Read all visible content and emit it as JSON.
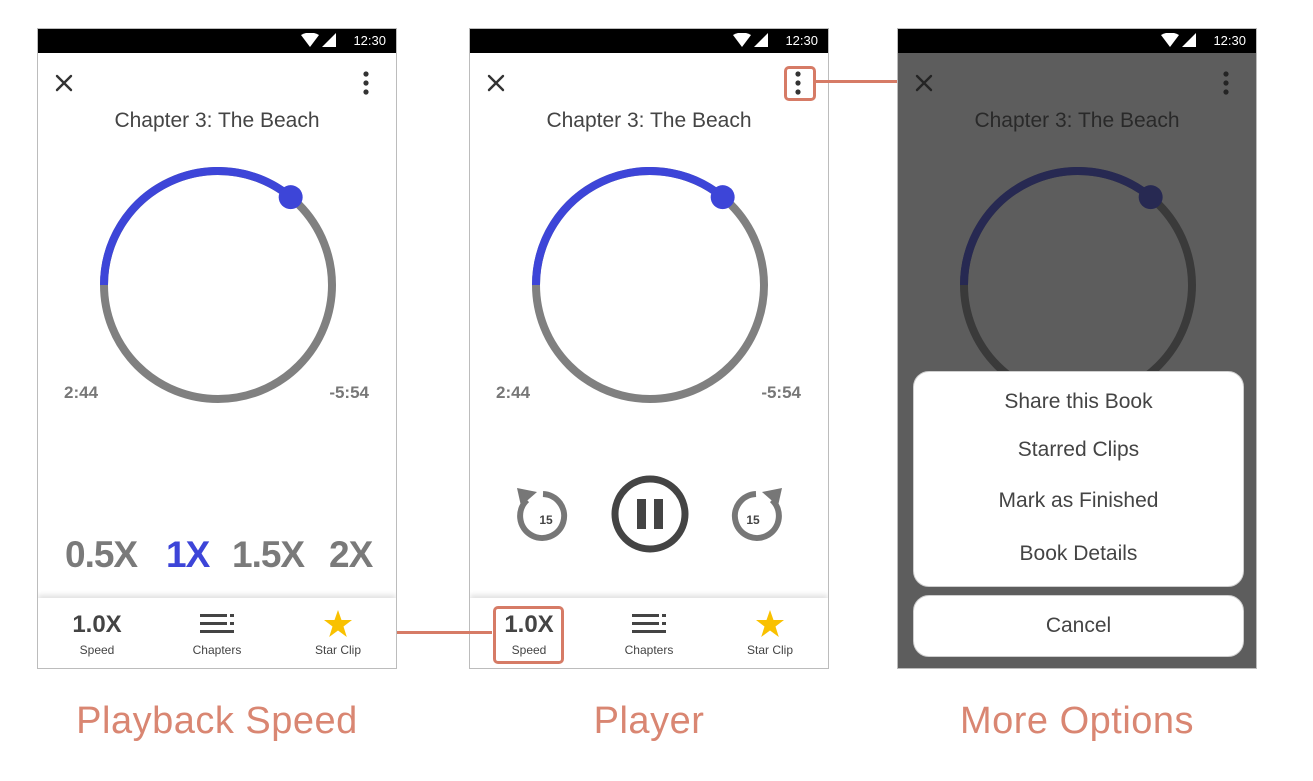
{
  "status_bar": {
    "time": "12:30"
  },
  "chapter_title": "Chapter 3: The Beach",
  "elapsed_time": "2:44",
  "remaining_time": "-5:54",
  "progress_fraction": 0.36,
  "colors": {
    "accent": "#3d45d8",
    "track": "#808080",
    "highlight": "#d67b66",
    "star": "#f9c100"
  },
  "speed_options": [
    {
      "label": "0.5X",
      "active": false
    },
    {
      "label": "1X",
      "active": true
    },
    {
      "label": "1.5X",
      "active": false
    },
    {
      "label": "2X",
      "active": false
    }
  ],
  "bottom_bar": {
    "speed_value": "1.0X",
    "speed_label": "Speed",
    "chapters_label": "Chapters",
    "star_label": "Star Clip"
  },
  "controls": {
    "rewind_seconds": "15",
    "forward_seconds": "15"
  },
  "more_options": {
    "items": [
      "Share this Book",
      "Starred Clips",
      "Mark as Finished",
      "Book Details"
    ],
    "cancel_label": "Cancel"
  },
  "captions": {
    "playback_speed": "Playback Speed",
    "player": "Player",
    "more_options": "More Options"
  },
  "icons": [
    "close-icon",
    "more-vert-icon",
    "wifi-icon",
    "signal-icon",
    "chapters-list-icon",
    "star-icon",
    "rewind-15-icon",
    "pause-icon",
    "forward-15-icon"
  ]
}
